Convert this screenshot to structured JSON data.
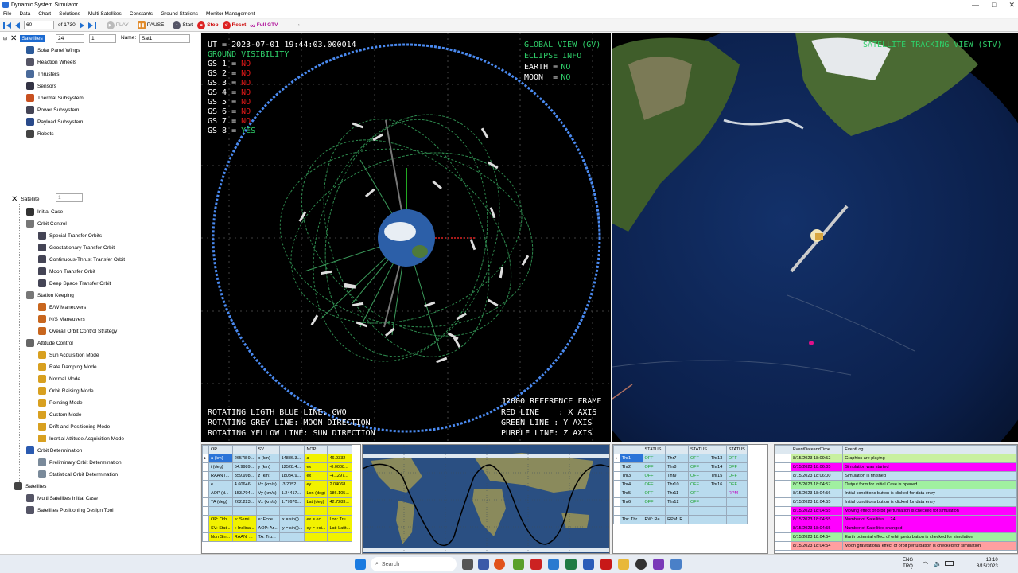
{
  "window": {
    "title": "Dynamic System Simulator"
  },
  "menu": [
    "File",
    "Data",
    "Chart",
    "Solutions",
    "Multi Satellites",
    "Constants",
    "Ground Stations",
    "Monitor Management"
  ],
  "toolbar": {
    "step_value": "60",
    "of_label": "of 1730",
    "play": "PLAY",
    "pause": "PAUSE",
    "start": "Start",
    "stop": "Stop",
    "reset": "Reset",
    "full_gtv": "Full GTV"
  },
  "satellites_header": {
    "label": "Satellites",
    "count": "24",
    "index": "1",
    "name_label": "Name:",
    "name_value": "Sat1"
  },
  "tree_top": [
    "Solar Panel Wings",
    "Reaction Wheels",
    "Thrusters",
    "Sensors",
    "Thermal Subsystem",
    "Power Subsystem",
    "Payload Subsystem",
    "Robots"
  ],
  "tree_main": {
    "satellite_label": "Satellite",
    "satellite_index": "1",
    "initial_case": "Initial Case",
    "orbit_control": "Orbit Control",
    "orbit_control_items": [
      "Special Transfer Orbits",
      "Geostationary Transfer Orbit",
      "Continuous-Thrust Transfer Orbit",
      "Moon Transfer Orbit",
      "Deep Space Transfer Orbit"
    ],
    "station_keeping": "Station Keeping",
    "station_keeping_items": [
      "E/W Maneuvers",
      "N/S Maneuvers",
      "Overall Orbit Control Strategy"
    ],
    "attitude_control": "Attitude Control",
    "attitude_items": [
      "Sun Acquisition Mode",
      "Rate Damping Mode",
      "Normal Mode",
      "Orbit Raising Mode",
      "Pointing Mode",
      "Custom Mode",
      "Drift and Positioning Mode",
      "Inertial Attitude Acquisition Mode"
    ],
    "orbit_determination": "Orbit Determination",
    "od_items": [
      "Preliminary Orbit Determination",
      "Statistical Orbit Determination"
    ],
    "satellites": "Satellites",
    "sat_items": [
      "Multi Satellites Initial Case",
      "Satellites Positioning Design Tool"
    ]
  },
  "global_view": {
    "ut": "UT = 2023-07-01 19:44:03.000014",
    "ground_visibility": "GROUND VISIBILITY",
    "gs": [
      {
        "label": "GS 1 =",
        "value": "NO"
      },
      {
        "label": "GS 2 =",
        "value": "NO"
      },
      {
        "label": "GS 3 =",
        "value": "NO"
      },
      {
        "label": "GS 4 =",
        "value": "NO"
      },
      {
        "label": "GS 5 =",
        "value": "NO"
      },
      {
        "label": "GS 6 =",
        "value": "NO"
      },
      {
        "label": "GS 7 =",
        "value": "NO"
      },
      {
        "label": "GS 8 =",
        "value": "YES"
      }
    ],
    "title": "GLOBAL VIEW (GV)",
    "eclipse_info": "ECLIPSE INFO",
    "earth_label": "EARTH =",
    "earth_value": "NO",
    "moon_label": "MOON  =",
    "moon_value": "NO",
    "legend_left": [
      "ROTATING LIGTH BLUE LINE: GWO",
      "ROTATING GREY LINE: MOON DIRECTION",
      "ROTATING YELLOW LINE: SUN DIRECTION"
    ],
    "legend_right": [
      "J2000 REFERENCE FRAME",
      "RED LINE    : X AXIS",
      "GREEN LINE : Y AXIS",
      "PURPLE LINE: Z AXIS"
    ]
  },
  "tracking_view": {
    "title": "SATELLITE TRACKING VIEW (STV)"
  },
  "elements_table": {
    "headers": [
      "",
      "OP",
      "",
      "SV",
      "",
      "NOP",
      ""
    ],
    "rows": [
      [
        "a (km)",
        "26578.9...",
        "x (km)",
        "14886.3...",
        "a",
        "46.9332"
      ],
      [
        "i (deg)",
        "54.9989...",
        "y (km)",
        "12528.4...",
        "ex",
        "-0.0008..."
      ],
      [
        "RAAN (...",
        "359.998...",
        "z (km)",
        "18034.9...",
        "ex",
        "-4.1297..."
      ],
      [
        "e",
        "4.60646...",
        "Vx (km/s)",
        "-3.2052...",
        "ey",
        "2.04068..."
      ],
      [
        "AOP (d...",
        "153.704...",
        "Vy (km/s)",
        "1.24417...",
        "Lon (deg)",
        "186.105..."
      ],
      [
        "TA (deg)",
        "262.223...",
        "Vz (km/s)",
        "1.77670...",
        "Lat (deg)",
        "42.7283..."
      ],
      [
        "",
        "",
        "",
        "",
        "",
        ""
      ],
      [
        "OP: Orb...",
        "a: Semi...",
        "e: Ecce...",
        "ix = sin(i)...",
        "ex = ec...",
        "Lon: Tru..."
      ],
      [
        "SV: Stat...",
        "i: Inclina...",
        "AOP: Ar...",
        "iy = sin(i)...",
        "ey = ect...",
        "Lat: Latit..."
      ],
      [
        "Non Sin...",
        "RAAN: ...",
        "TA: Tru...",
        "",
        "",
        ""
      ]
    ]
  },
  "thrusters_table": {
    "headers": [
      "",
      "STATUS",
      "",
      "STATUS",
      "",
      "STATUS"
    ],
    "rows": [
      [
        "Thr1",
        "OFF",
        "Thr7",
        "OFF",
        "Thr13",
        "OFF"
      ],
      [
        "Thr2",
        "OFF",
        "Thr8",
        "OFF",
        "Thr14",
        "OFF"
      ],
      [
        "Thr3",
        "OFF",
        "Thr9",
        "OFF",
        "Thr15",
        "OFF"
      ],
      [
        "Thr4",
        "OFF",
        "Thr10",
        "OFF",
        "Thr16",
        "OFF"
      ],
      [
        "Thr5",
        "OFF",
        "Thr11",
        "OFF",
        "",
        "RPM"
      ],
      [
        "Thr6",
        "OFF",
        "Thr12",
        "OFF",
        "",
        ""
      ],
      [
        "",
        "",
        "",
        "",
        "",
        ""
      ],
      [
        "Thr: Thr...",
        "RW: Re...",
        "RPM: R...",
        "",
        "",
        ""
      ]
    ]
  },
  "event_log": {
    "headers": [
      "EventDateandTime",
      "EventLog"
    ],
    "rows": [
      {
        "time": "8/15/2023 18:09:52",
        "text": "Graphics are playing",
        "color": "#c8f0a0"
      },
      {
        "time": "8/15/2023 18:06:05",
        "text": "Simulation was started",
        "color": "#ff00ff"
      },
      {
        "time": "8/15/2023 18:06:00",
        "text": "Simulation is finished",
        "color": "#bfe0f0"
      },
      {
        "time": "8/15/2023 18:04:57",
        "text": "Output form for Initial Case is opened",
        "color": "#a0f0a0"
      },
      {
        "time": "8/15/2023 18:04:56",
        "text": "Initial conditions button is clicked for data entry",
        "color": "#bfe0f0"
      },
      {
        "time": "8/15/2023 18:04:55",
        "text": "Initial conditions button is clicked for data entry",
        "color": "#bfe0f0"
      },
      {
        "time": "8/15/2023 18:04:55",
        "text": "Moving effect of orbit perturbation is checked for simulation",
        "color": "#ff00ff"
      },
      {
        "time": "8/15/2023 18:04:55",
        "text": "Number of Satellites ... 24",
        "color": "#ff00ff"
      },
      {
        "time": "8/15/2023 18:04:55",
        "text": "Number of Satellites changed",
        "color": "#ff00ff"
      },
      {
        "time": "8/15/2023 18:04:54",
        "text": "Earth potential effect of orbit perturbation is checked for simulation",
        "color": "#a0f0a0"
      },
      {
        "time": "8/15/2023 18:04:54",
        "text": "Moon gravitational effect of orbit perturbation is checked for simulation",
        "color": "#ff9fa0"
      }
    ]
  },
  "taskbar": {
    "search": "Search",
    "lang_top": "ENG",
    "lang_bottom": "TRQ",
    "time": "18:10",
    "date": "8/15/2023"
  }
}
